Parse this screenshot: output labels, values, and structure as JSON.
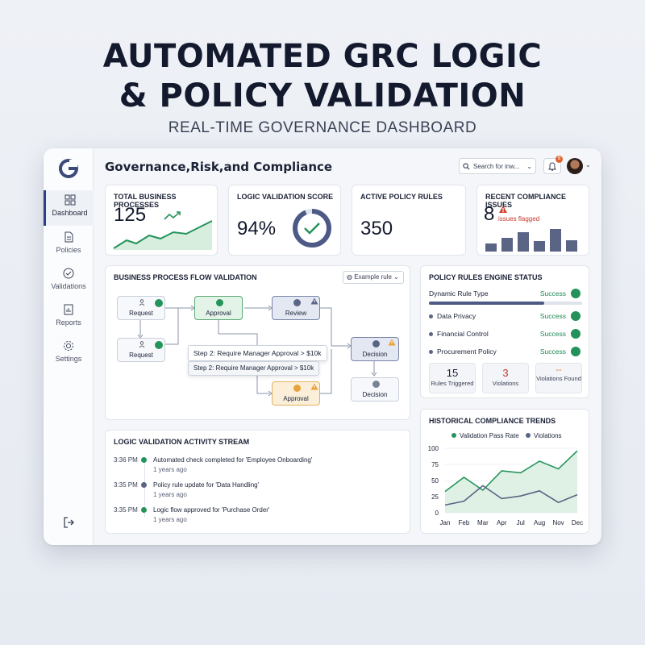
{
  "hero": {
    "title_line1": "AUTOMATED GRC LOGIC",
    "title_line2": "& POLICY VALIDATION",
    "subtitle": "REAL-TIME GOVERNANCE DASHBOARD"
  },
  "app": {
    "title": "Governance,Risk,and Compliance",
    "search_placeholder": "Search for inw...",
    "notification_count": "8"
  },
  "sidebar": {
    "items": [
      {
        "label": "Dashboard",
        "icon": "grid-icon",
        "active": true
      },
      {
        "label": "Policies",
        "icon": "document-icon"
      },
      {
        "label": "Validations",
        "icon": "check-circle-icon"
      },
      {
        "label": "Reports",
        "icon": "bar-report-icon"
      },
      {
        "label": "Settings",
        "icon": "gear-icon"
      }
    ]
  },
  "kpis": {
    "processes": {
      "title": "TOTAL BUSINESS PROCESSES",
      "value": "125"
    },
    "score": {
      "title": "LOGIC VALIDATION SCORE",
      "value": "94%",
      "percent": 94
    },
    "rules": {
      "title": "ACTIVE POLICY RULES",
      "value": "350"
    },
    "issues": {
      "title": "RECENT COMPLIANCE ISSUES",
      "value": "8",
      "note": "issues flagged"
    }
  },
  "flow": {
    "title": "BUSINESS PROCESS FLOW VALIDATION",
    "dropdown": "Example rule",
    "nodes": {
      "request1": "Request",
      "request2": "Request",
      "approval": "Approval",
      "review": "Review",
      "decision1": "Decision",
      "approval2": "Approval",
      "decision2": "Decision"
    },
    "tooltip_main": "Step 2: Require Manager Approval > $10k",
    "tooltip_sub": "Step 2: Require Manager Approval > $10k"
  },
  "engine": {
    "title": "POLICY RULES ENGINE STATUS",
    "rows": [
      {
        "label": "Dynamic Rule Type",
        "status": "Success"
      },
      {
        "label": "Data Privacy",
        "status": "Success"
      },
      {
        "label": "Financial Control",
        "status": "Success"
      },
      {
        "label": "Procurement Policy",
        "status": "Success"
      }
    ],
    "stats": [
      {
        "value": "15",
        "label": "Rules Triggered"
      },
      {
        "value": "3",
        "label": "Violations"
      },
      {
        "value": "--",
        "label": "Violations Found"
      }
    ]
  },
  "activity": {
    "title": "LOGIC VALIDATION ACTIVITY STREAM",
    "rows": [
      {
        "time": "3:36 PM",
        "msg": "Automated check completed for 'Employee Onboarding'",
        "ago": "1 years ago"
      },
      {
        "time": "3:35 PM",
        "msg": "Policy rule update for 'Data Handling'",
        "ago": "1 years ago"
      },
      {
        "time": "3:35 PM",
        "msg": "Logic flow approved for 'Purchase Order'",
        "ago": "1 years ago"
      }
    ]
  },
  "colors": {
    "green": "#25945a",
    "navy": "#5a6585",
    "red": "#c43a2e",
    "orange": "#e9a23b"
  },
  "chart_data": {
    "type": "line",
    "title": "HISTORICAL COMPLIANCE TRENDS",
    "categories": [
      "Jan",
      "Feb",
      "Mar",
      "Apr",
      "Jul",
      "Aug",
      "Nov",
      "Dec"
    ],
    "ylim": [
      0,
      100
    ],
    "yticks": [
      "0",
      "25",
      "50",
      "75",
      "100"
    ],
    "legend_position": "top",
    "series": [
      {
        "name": "Validation Pass Rate",
        "values": [
          33,
          55,
          35,
          65,
          62,
          80,
          68,
          96
        ],
        "color": "#25945a"
      },
      {
        "name": "Violations",
        "values": [
          12,
          18,
          42,
          22,
          26,
          34,
          16,
          28
        ],
        "color": "#5a6585"
      }
    ]
  }
}
